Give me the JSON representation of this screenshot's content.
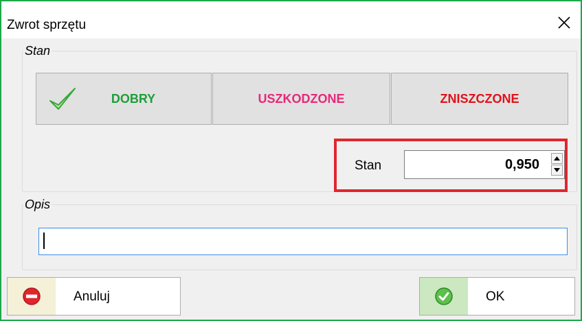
{
  "window": {
    "title": "Zwrot sprzętu"
  },
  "stan_group": {
    "legend": "Stan",
    "buttons": [
      {
        "label": "DOBRY",
        "color": "#1e9e3a",
        "selected": true
      },
      {
        "label": "USZKODZONE",
        "color": "#e8287a",
        "selected": false
      },
      {
        "label": "ZNISZCZONE",
        "color": "#e0121a",
        "selected": false
      }
    ],
    "stan_label": "Stan",
    "stan_value": "0,950"
  },
  "opis_group": {
    "legend": "Opis",
    "value": ""
  },
  "actions": {
    "cancel_label": "Anuluj",
    "ok_label": "OK"
  },
  "colors": {
    "window_border": "#1ea84b",
    "highlight_border": "#e0262d",
    "input_focus": "#3a8ee6"
  }
}
